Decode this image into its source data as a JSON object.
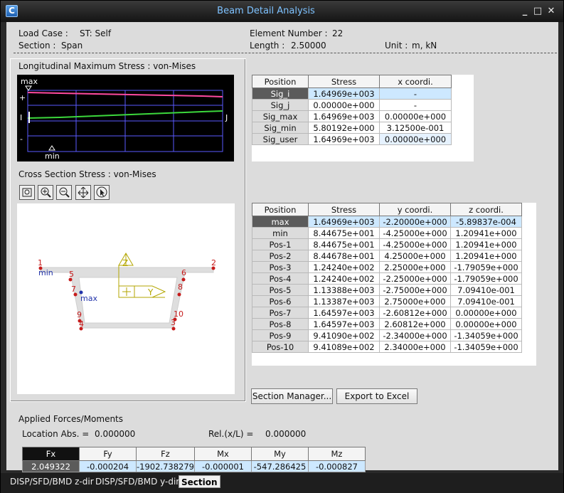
{
  "window": {
    "title": "Beam Detail Analysis"
  },
  "header": {
    "load_case_label": "Load Case :",
    "load_case_value": "ST: Self",
    "section_label": "Section :",
    "section_value": "Span",
    "element_number_label": "Element Number :",
    "element_number_value": "22",
    "length_label": "Length :",
    "length_value": "2.50000",
    "unit_label": "Unit :",
    "unit_value": "m,  kN"
  },
  "longitudinal": {
    "title": "Longitudinal Maximum Stress :  von-Mises",
    "marker_max": "max",
    "marker_min": "min",
    "left_plus": "+",
    "left_i": "I",
    "left_minus": "-",
    "right_j": "J"
  },
  "cross_section": {
    "title": "Cross Section Stress :   von-Mises",
    "max_label": "max",
    "min_label": "min",
    "axis_z": "Z",
    "axis_y": "Y",
    "point_labels": [
      "1",
      "2",
      "4",
      "3",
      "5",
      "6",
      "7",
      "8",
      "9",
      "10"
    ]
  },
  "toolbar": {
    "icons": [
      "zoom-fit-icon",
      "zoom-in-icon",
      "zoom-out-icon",
      "pan-icon",
      "select-icon"
    ]
  },
  "stress_table": {
    "headers": [
      "Position",
      "Stress",
      "x coordi."
    ],
    "rows": [
      [
        "Sig_i",
        "1.64969e+003",
        "-"
      ],
      [
        "Sig_j",
        "0.00000e+000",
        "-"
      ],
      [
        "Sig_max",
        "1.64969e+003",
        "0.00000e+000"
      ],
      [
        "Sig_min",
        "5.80192e+000",
        "3.12500e-001"
      ],
      [
        "Sig_user",
        "1.64969e+003",
        "0.00000e+000"
      ]
    ]
  },
  "section_table": {
    "headers": [
      "Position",
      "Stress",
      "y coordi.",
      "z coordi."
    ],
    "rows": [
      [
        "max",
        "1.64969e+003",
        "-2.20000e+000",
        "-5.89837e-004"
      ],
      [
        "min",
        "8.44675e+001",
        "-4.25000e+000",
        "1.20941e+000"
      ],
      [
        "Pos-1",
        "8.44675e+001",
        "-4.25000e+000",
        "1.20941e+000"
      ],
      [
        "Pos-2",
        "8.44678e+001",
        "4.25000e+000",
        "1.20941e+000"
      ],
      [
        "Pos-3",
        "1.24240e+002",
        "2.25000e+000",
        "-1.79059e+000"
      ],
      [
        "Pos-4",
        "1.24240e+002",
        "-2.25000e+000",
        "-1.79059e+000"
      ],
      [
        "Pos-5",
        "1.13388e+003",
        "-2.75000e+000",
        "7.09410e-001"
      ],
      [
        "Pos-6",
        "1.13387e+003",
        "2.75000e+000",
        "7.09410e-001"
      ],
      [
        "Pos-7",
        "1.64597e+003",
        "-2.60812e+000",
        "0.00000e+000"
      ],
      [
        "Pos-8",
        "1.64597e+003",
        "2.60812e+000",
        "0.00000e+000"
      ],
      [
        "Pos-9",
        "9.41090e+002",
        "-2.34000e+000",
        "-1.34059e+000"
      ],
      [
        "Pos-10",
        "9.41089e+002",
        "2.34000e+000",
        "-1.34059e+000"
      ]
    ]
  },
  "buttons": {
    "section_manager": "Section Manager...",
    "export_excel": "Export to Excel"
  },
  "forces": {
    "title": "Applied Forces/Moments",
    "location_label": "Location Abs. =",
    "location_value": "0.000000",
    "rel_label": "Rel.(x/L) =",
    "rel_value": "0.000000",
    "headers": [
      "Fx",
      "Fy",
      "Fz",
      "Mx",
      "My",
      "Mz"
    ],
    "values": [
      "2.049322",
      "-0.000204",
      "-1902.738279",
      "-0.000001",
      "-547.286425",
      "-0.000827"
    ]
  },
  "tabs": [
    {
      "label": "DISP/SFD/BMD z-dir"
    },
    {
      "label": "DISP/SFD/BMD y-dir"
    },
    {
      "label": "Section"
    }
  ],
  "colors": {
    "graph_top": "#ff4aa0",
    "graph_mid": "#3cd83c",
    "grid": "#5a5aff",
    "highlight": "#cde8ff"
  }
}
